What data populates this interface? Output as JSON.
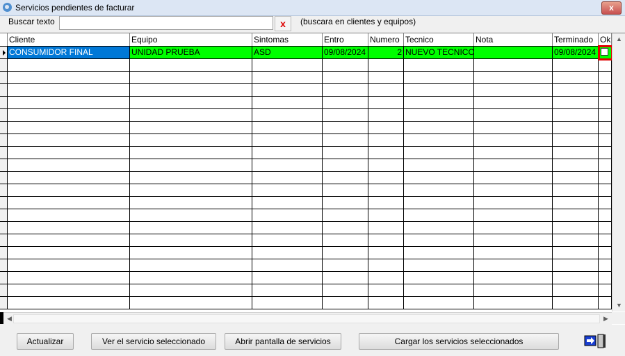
{
  "window": {
    "title": "Servicios pendientes de facturar",
    "close_label": "x"
  },
  "search": {
    "label": "Buscar texto",
    "value": "",
    "placeholder": "",
    "clear_label": "x",
    "hint": "(buscara en clientes y equipos)"
  },
  "table": {
    "columns": [
      "Cliente",
      "Equipo",
      "Sintomas",
      "Entro",
      "Numero",
      "Tecnico",
      "Nota",
      "Terminado",
      "Ok"
    ],
    "rows": [
      {
        "cliente": "CONSUMIDOR FINAL",
        "equipo": "UNIDAD PRUEBA",
        "sintomas": "ASD",
        "entro": "09/08/2024",
        "numero": "2",
        "tecnico": "NUEVO TECNICO",
        "nota": "",
        "terminado": "09/08/2024",
        "ok": false
      }
    ]
  },
  "buttons": {
    "actualizar": "Actualizar",
    "ver": "Ver el servicio seleccionado",
    "abrir": "Abrir pantalla de servicios",
    "cargar": "Cargar los servicios seleccionados"
  },
  "colors": {
    "selected_row": "#00ff00",
    "selected_cell": "#0078d7",
    "highlight": "#e00000"
  },
  "icons": {
    "exit": "exit-door-arrow-icon",
    "app": "app-logo-icon"
  }
}
